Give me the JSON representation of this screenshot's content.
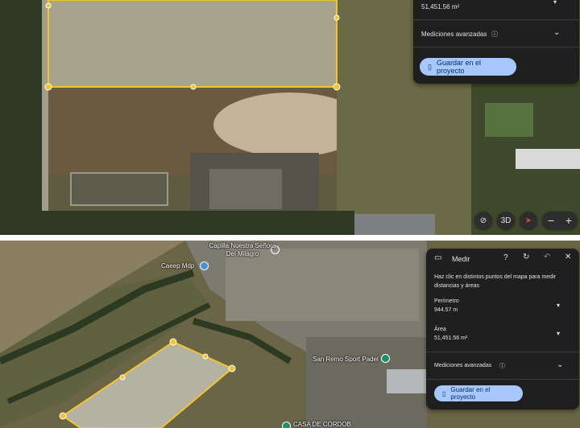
{
  "top_panel": {
    "area_value": "51,451.56 m²",
    "advanced_label": "Mediciones avanzadas",
    "save_label": "Guardar en el proyecto"
  },
  "map_controls": {
    "threeD_label": "3D"
  },
  "bottom_panel": {
    "title": "Medir",
    "hint": "Haz clic en distintos puntos del mapa para medir distancias y áreas",
    "perimeter_label": "Perímetro",
    "perimeter_value": "944.57 m",
    "area_label": "Área",
    "area_value": "51,451.56 m²",
    "advanced_label": "Mediciones avanzadas",
    "save_label": "Guardar en el proyecto"
  },
  "map_labels": {
    "chapel": "Capilla Nuestra Señora Del Milagro",
    "caeep": "Caeep Mdp",
    "padel": "San Remo Sport Padel",
    "casa": "CASA DE CORDOB"
  },
  "colors": {
    "panel_bg": "#1f1f1f",
    "save_button": "#a8c7fa",
    "polygon_outline": "#f4c430"
  }
}
